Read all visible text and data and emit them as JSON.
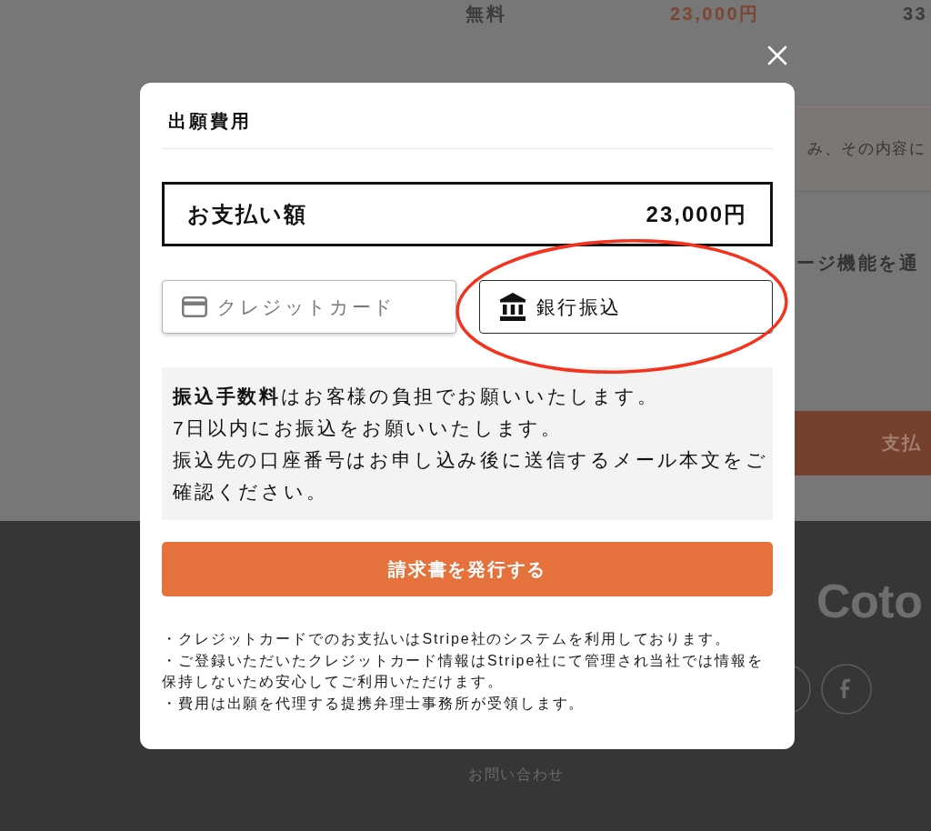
{
  "background": {
    "price_row": [
      {
        "kind": "label",
        "text": "無料"
      },
      {
        "kind": "price",
        "text": "23,000円"
      },
      {
        "kind": "label",
        "text": "33"
      }
    ],
    "notice_text": "み、その内容に",
    "section_heading": "ージ機能を通",
    "pay_button": "支払",
    "footer": {
      "logo": "Coto",
      "links": [
        "お問い合わせ"
      ]
    }
  },
  "modal": {
    "title": "出願費用",
    "amount": {
      "label": "お支払い額",
      "value": "23,000円"
    },
    "methods": [
      {
        "kind": "card",
        "label": "クレジットカード",
        "selected": false,
        "circled": false
      },
      {
        "kind": "bank",
        "label": "銀行振込",
        "selected": true,
        "circled": true
      }
    ],
    "info": [
      "**振込手数料**はお客様の負担でお願いいたします。",
      "7日以内にお振込をお願いいたします。",
      "振込先の口座番号はお申し込み後に送信するメール本文をご確認ください。"
    ],
    "submit_button": "請求書を発行する",
    "notes": [
      "・クレジットカードでのお支払いはStripe社のシステムを利用しております。",
      "・ご登録いただいたクレジットカード情報はStripe社にて管理され当社では情報を保持しないため安心してご利用いただけます。",
      "・費用は出願を代理する提携弁理士事務所が受領します。"
    ]
  }
}
